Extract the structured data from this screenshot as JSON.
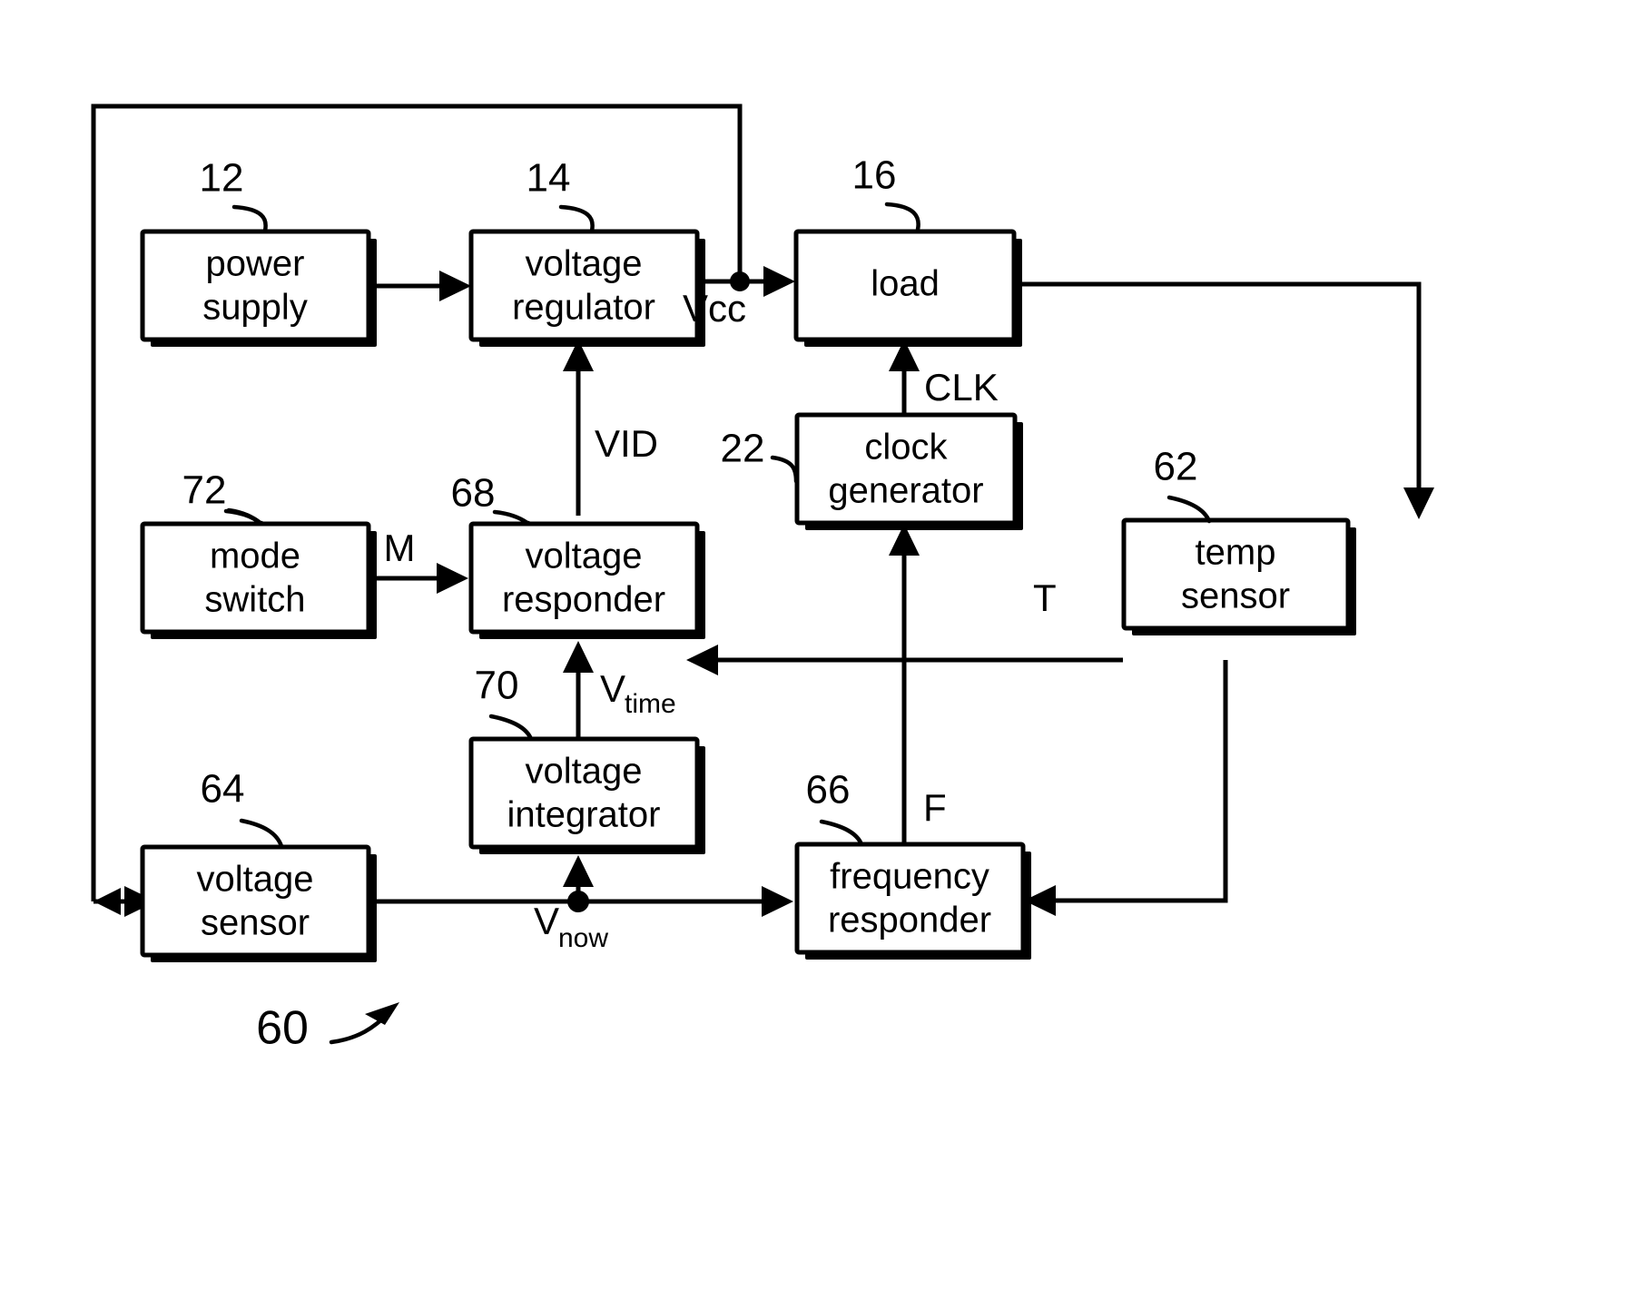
{
  "figure": {
    "reference_numeral": "60",
    "type": "block-diagram"
  },
  "blocks": [
    {
      "id": "power_supply",
      "ref": "12",
      "line1": "power",
      "line2": "supply"
    },
    {
      "id": "voltage_regulator",
      "ref": "14",
      "line1": "voltage",
      "line2": "regulator"
    },
    {
      "id": "load",
      "ref": "16",
      "line1": "load",
      "line2": ""
    },
    {
      "id": "clock_generator",
      "ref": "22",
      "line1": "clock",
      "line2": "generator"
    },
    {
      "id": "temp_sensor",
      "ref": "62",
      "line1": "temp",
      "line2": "sensor"
    },
    {
      "id": "mode_switch",
      "ref": "72",
      "line1": "mode",
      "line2": "switch"
    },
    {
      "id": "voltage_responder",
      "ref": "68",
      "line1": "voltage",
      "line2": "responder"
    },
    {
      "id": "voltage_integrator",
      "ref": "70",
      "line1": "voltage",
      "line2": "integrator"
    },
    {
      "id": "voltage_sensor",
      "ref": "64",
      "line1": "voltage",
      "line2": "sensor"
    },
    {
      "id": "frequency_responder",
      "ref": "66",
      "line1": "frequency",
      "line2": "responder"
    }
  ],
  "signals": {
    "vcc": {
      "base": "Vcc",
      "sub": ""
    },
    "vid": {
      "base": "VID",
      "sub": ""
    },
    "clk": {
      "base": "CLK",
      "sub": ""
    },
    "m": {
      "base": "M",
      "sub": ""
    },
    "t": {
      "base": "T",
      "sub": ""
    },
    "f": {
      "base": "F",
      "sub": ""
    },
    "vtime": {
      "base": "V",
      "sub": "time"
    },
    "vnow": {
      "base": "V",
      "sub": "now"
    }
  },
  "colors": {
    "ink": "#000000",
    "paper": "#ffffff"
  }
}
